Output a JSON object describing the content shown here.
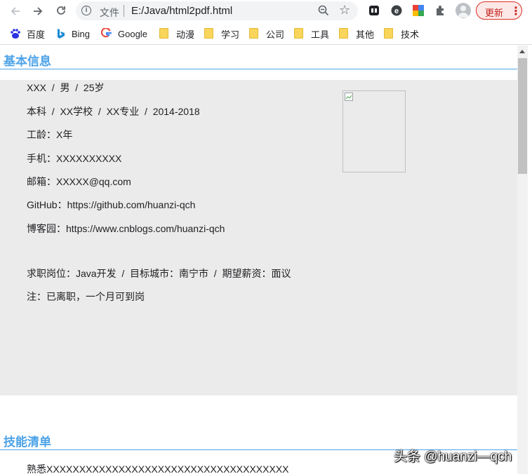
{
  "toolbar": {
    "back_icon": "arrow-left-icon",
    "forward_icon": "arrow-right-icon",
    "reload_icon": "reload-icon",
    "scheme_label": "文件",
    "url": "E:/Java/html2pdf.html",
    "update_label": "更新"
  },
  "bookmarks": [
    {
      "label": "百度",
      "icon": "baidu-icon"
    },
    {
      "label": "Bing",
      "icon": "bing-icon"
    },
    {
      "label": "Google",
      "icon": "google-icon"
    },
    {
      "label": "动漫",
      "icon": "folder-icon"
    },
    {
      "label": "学习",
      "icon": "folder-icon"
    },
    {
      "label": "公司",
      "icon": "folder-icon"
    },
    {
      "label": "工具",
      "icon": "folder-icon"
    },
    {
      "label": "其他",
      "icon": "folder-icon"
    },
    {
      "label": "技术",
      "icon": "folder-icon"
    }
  ],
  "page": {
    "basic_title": "基本信息",
    "basic_lines": [
      "XXX  /  男  /  25岁",
      "本科  /  XX学校  /  XX专业  /  2014-2018",
      "工龄：X年",
      "手机：XXXXXXXXXX",
      "邮箱：XXXXX@qq.com",
      "GitHub：https://github.com/huanzi-qch",
      "博客园：https://www.cnblogs.com/huanzi-qch",
      "求职岗位：Java开发  /  目标城市：南宁市  /  期望薪资：面议",
      "注：已离职，一个月可到岗"
    ],
    "skills_title": "技能清单",
    "skills_first": "熟悉XXXXXXXXXXXXXXXXXXXXXXXXXXXXXXXXXXXXX"
  },
  "watermark": "头条 @huanzi—qch",
  "colors": {
    "accent": "#4da3e8",
    "info_bg": "#ebebeb",
    "update_red": "#d93025"
  }
}
